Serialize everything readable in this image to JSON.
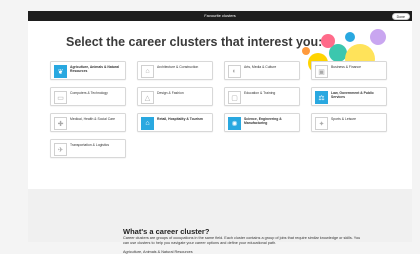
{
  "topbar": {
    "title": "Favourite clusters",
    "done_label": "Done"
  },
  "heading": "Select the career clusters that interest you:",
  "cards": [
    {
      "label": "Agriculture, Animals & Natural Resources",
      "icon": "plant-icon",
      "selected": true
    },
    {
      "label": "Architecture & Construction",
      "icon": "building-icon",
      "selected": false
    },
    {
      "label": "Arts, Media & Culture",
      "icon": "palette-icon",
      "selected": false
    },
    {
      "label": "Business & Finance",
      "icon": "briefcase-icon",
      "selected": false
    },
    {
      "label": "Computers & Technology",
      "icon": "laptop-icon",
      "selected": false
    },
    {
      "label": "Design & Fashion",
      "icon": "dress-icon",
      "selected": false
    },
    {
      "label": "Education & Training",
      "icon": "chalkboard-icon",
      "selected": false
    },
    {
      "label": "Law, Government & Public Services",
      "icon": "gavel-icon",
      "selected": true
    },
    {
      "label": "Medical, Health & Social Care",
      "icon": "first-aid-icon",
      "selected": false
    },
    {
      "label": "Retail, Hospitality & Tourism",
      "icon": "shop-icon",
      "selected": true
    },
    {
      "label": "Science, Engineering & Manufacturing",
      "icon": "atom-icon",
      "selected": true
    },
    {
      "label": "Sports & Leisure",
      "icon": "figure-icon",
      "selected": false
    },
    {
      "label": "Transportation & Logistics",
      "icon": "plane-icon",
      "selected": false
    }
  ],
  "footer": {
    "title": "What's a career cluster?",
    "body": "Career clusters are groups of occupations in the same field. Each cluster contains a group of jobs that require similar knowledge or skills. You can use clusters to help you navigate your career options and define your educational path.",
    "first_item": "Agriculture, Animals & Natural Resources"
  },
  "colors": {
    "selected": "#29a8e0",
    "topbar": "#1e1e1e"
  }
}
